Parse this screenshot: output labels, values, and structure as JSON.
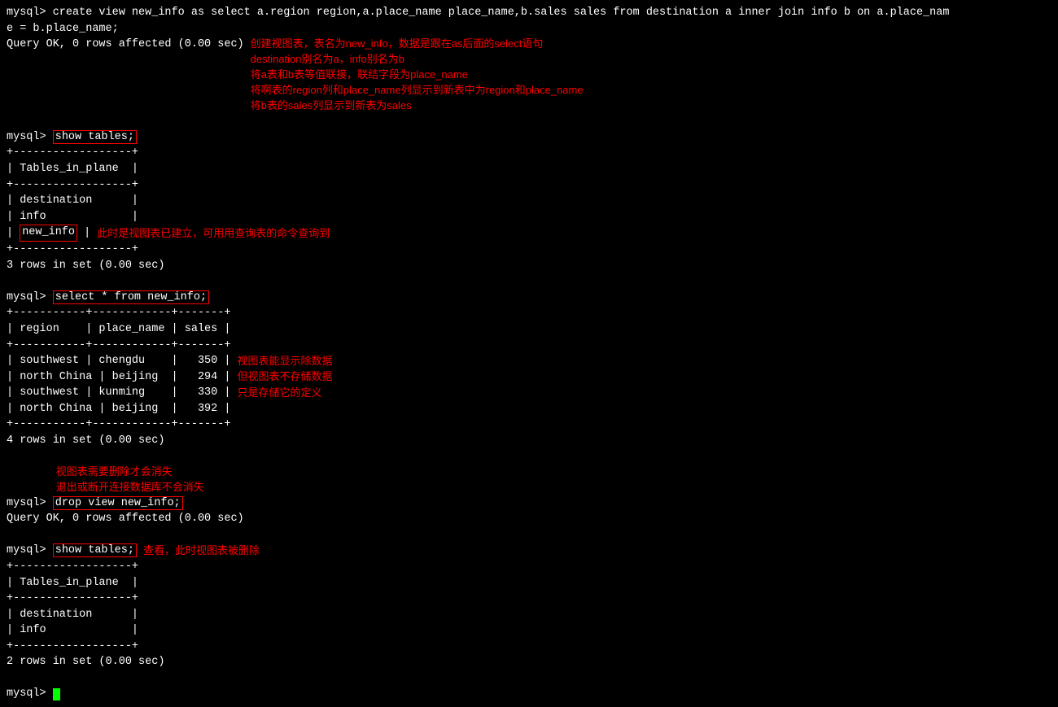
{
  "terminal": {
    "bg": "#000000",
    "text_color": "#ffffff",
    "red_color": "#ff0000",
    "green_color": "#00ff00",
    "lines": {
      "cmd1": "mysql> create view new_info as select a.region region,a.place_name place_name,b.sales sales from destination a inner join info b on a.place_nam",
      "cmd1_cont": "e = b.place_name;",
      "cmd1_result": "Query OK, 0 rows affected (0.00 sec)",
      "ann1_1": "创建视图表，表名为new_info，数据是跟在as后面的select语句",
      "ann1_2": "destination别名为a，info别名为b",
      "ann1_3": "将a表和b表等值联接，联结字段为place_name",
      "ann1_4": "将啊表的region列和place_name列显示到新表中为region和place_name",
      "ann1_5": "将b表的sales列显示到新表为sales",
      "cmd2": "mysql> show tables;",
      "table1_header": "+------------------+",
      "table1_col": "| Tables_in_plane  |",
      "table1_row1": "| destination      |",
      "table1_row2": "| info             |",
      "table1_row3_pre": "| ",
      "table1_row3_boxed": "new_info",
      "table1_row3_post": " |",
      "ann2": "此时是视图表已建立，可用用查询表的命令查询到",
      "table1_footer": "+------------------+",
      "table1_count": "3 rows in set (0.00 sec)",
      "cmd3": "mysql> select * from new_info;",
      "table2_header": "+-----------+------------+-------+",
      "table2_col": "| region    | place_name | sales |",
      "table2_sep": "+-----------+------------+-------+",
      "table2_r1": "| southwest | chengdu    |   350 |",
      "table2_r2": "| north China | beijing  |   294 |",
      "table2_r3": "| southwest | kunming    |   330 |",
      "table2_r4": "| north China | beijing  |   392 |",
      "table2_footer": "+-----------+------------+-------+",
      "table2_count": "4 rows in set (0.00 sec)",
      "ann3_1": "视图表能显示除数据",
      "ann3_2": "但视图表不存储数据",
      "ann3_3": "只是存储它的定义",
      "ann4_1": "视图表需要删除才会消失",
      "ann4_2": "退出或断开连接数据库不会消失",
      "cmd4_pre": "mysql> ",
      "cmd4_boxed": "drop view new_info;",
      "cmd4_result": "Query OK, 0 rows affected (0.00 sec)",
      "cmd5_pre": "mysql> ",
      "cmd5_boxed": "show tables;",
      "ann5": "查看，此时视图表被删除",
      "table3_header": "+------------------+",
      "table3_col": "| Tables_in_plane  |",
      "table3_r1": "| destination      |",
      "table3_r2": "| info             |",
      "table3_footer": "+------------------+",
      "table3_count": "2 rows in set (0.00 sec)",
      "final_prompt": "mysql> "
    }
  }
}
